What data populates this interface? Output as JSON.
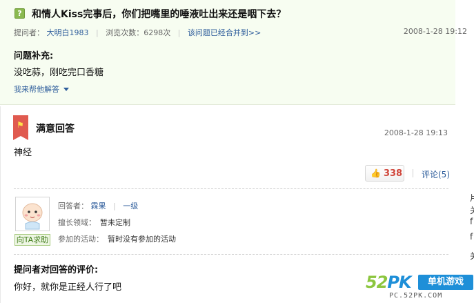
{
  "question": {
    "icon": "question-mark-icon",
    "icon_glyph": "?",
    "title": "和情人Kiss完事后，你们把嘴里的唾液吐出来还是咽下去？",
    "asker_label": "提问者：",
    "asker_name": "大明白1983",
    "views": "浏览次数：6298次",
    "merged_link": "该问题已经合并到>>",
    "date": "2008-1-28 19:12",
    "supplement_label": "问题补充:",
    "supplement_text": "没吃蒜，刚吃完口香糖",
    "help_link": "我来帮他解答"
  },
  "answer": {
    "title": "满意回答",
    "date": "2008-1-28 19:13",
    "text": "神经",
    "likes": "338",
    "comments": "评论(5)",
    "answerer_label": "回答者：",
    "answerer_name": "霖果",
    "answerer_level": "一级",
    "expertise_label": "擅长领域：",
    "expertise_value": "暂未定制",
    "activity_label": "参加的活动：",
    "activity_value": "暂时没有参加的活动",
    "ta_button": "向TA求助",
    "evaluation_label": "提问者对回答的评价:",
    "evaluation_text": "你好，就你是正经人行了吧"
  },
  "right_fragments": [
    "片",
    "关",
    "f",
    "f",
    "关"
  ],
  "watermark": {
    "logo_part1": "52",
    "logo_part2": "PK",
    "tag": "单机游戏",
    "url": "PC.52PK.COM"
  },
  "colors": {
    "accent_link": "#2f5e9c",
    "question_bg": "#f7fdf1",
    "like_red": "#d0463b",
    "ribbon_red": "#e05a4f"
  }
}
